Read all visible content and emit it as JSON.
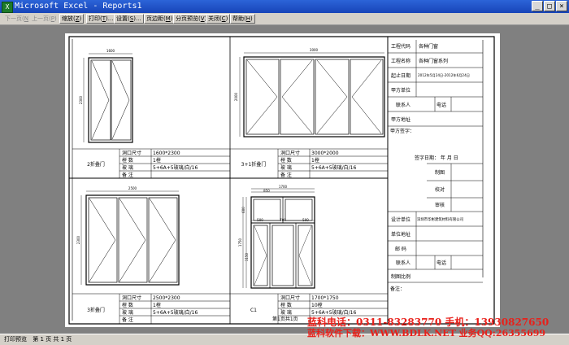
{
  "window": {
    "title": "Microsoft Excel - Reports1",
    "icon": "excel-icon"
  },
  "window_buttons": {
    "minimize": "_",
    "maximize": "□",
    "close": "×"
  },
  "toolbar": {
    "prev_page": {
      "label": "下一页",
      "key": "N"
    },
    "next_page": {
      "label": "上一页",
      "key": "P"
    },
    "zoom": {
      "label": "缩放",
      "key": "Z"
    },
    "print": {
      "label": "打印",
      "key": "T"
    },
    "setup": {
      "label": "设置",
      "key": "S"
    },
    "margins": {
      "label": "页边距",
      "key": "M"
    },
    "page_break": {
      "label": "分页预览",
      "key": "V"
    },
    "close": {
      "label": "关闭",
      "key": "C"
    },
    "help": {
      "label": "帮助",
      "key": "H"
    }
  },
  "sheet": {
    "cells": [
      {
        "name": "2折叠门",
        "size": "1600*2300",
        "count": "1樘",
        "glass": "5+6A+5玻璃/白/16",
        "note_label": "备  注"
      },
      {
        "name": "3+1折叠门",
        "size": "3000*2000",
        "count": "1樘",
        "glass": "5+6A+5玻璃/白/16",
        "note_label": "备  注"
      },
      {
        "name": "3折叠门",
        "size": "2500*2300",
        "count": "1樘",
        "glass": "5+6A+5玻璃/白/16",
        "note_label": "备  注"
      },
      {
        "name": "C1",
        "size": "1700*1750",
        "count": "10樘",
        "glass": "5+6A+5玻璃/白/16",
        "note_label": ""
      }
    ],
    "labels": {
      "size": "洞口尺寸",
      "count": "樘  数",
      "glass": "玻  璃"
    },
    "dims": {
      "d1_w": "1600",
      "d1_h": "2300",
      "d2_w": "3000",
      "d2_h": "2000",
      "d3_w": "2500",
      "d3_h": "2300",
      "c1_w": "1700",
      "c1_top": "850",
      "c1_side": "600",
      "c1_h": "1750",
      "c1_b1": "500",
      "c1_b2": "700",
      "c1_b3": "500",
      "c1_lh": "1150"
    },
    "page_label": "第1页共1页",
    "info": {
      "project_code_label": "工程代码",
      "project_code": "各种门窗",
      "project_name_label": "工程名称",
      "project_name": "各种门窗系列",
      "date_label": "起止日期",
      "date": "2012年5月24日-2012年6月24日",
      "client_label": "甲方单位",
      "contact_label": "联系人",
      "phone_label": "电话",
      "address_label": "甲方地址",
      "client_sign": "甲方签字：",
      "sign_date": "签字日期：   年  月  日",
      "drawing": "制图",
      "check": "校对",
      "review": "审核",
      "design_unit_label": "设计单位",
      "design_unit": "深圳市华彬建筑材料有限公司",
      "unit_address": "单位地址",
      "postcode": "邮  码",
      "contact2": "联系人",
      "phone2": "电话",
      "scale": "制图比例",
      "remark": "备注："
    }
  },
  "status": {
    "mode": "打印预览",
    "page": "第 1 页  共 1 页"
  },
  "watermark": {
    "line1": "蓝科电话：0311-83283770  手机：13930827650",
    "line2": "蓝科软件下载：WWW.BDLK.NET  业务QQ:26355699"
  }
}
